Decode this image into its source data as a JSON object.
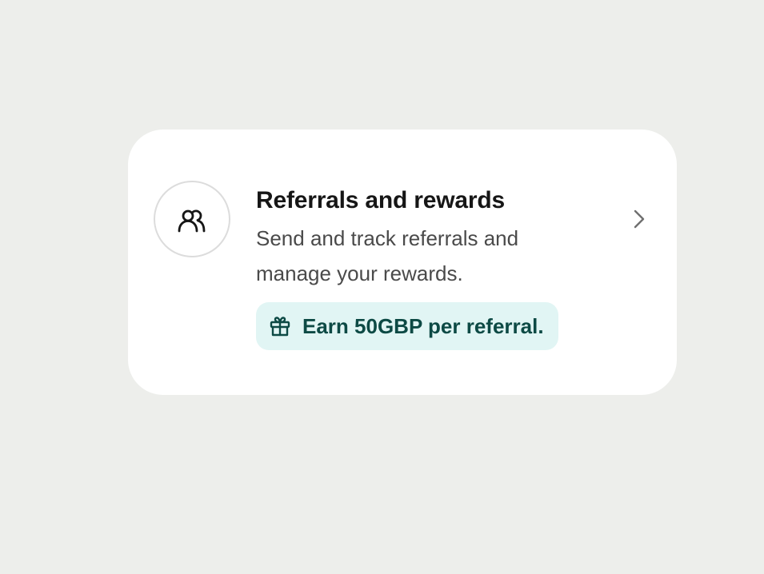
{
  "card": {
    "title": "Referrals and rewards",
    "description": "Send and track referrals and manage your rewards.",
    "badge": "Earn 50GBP per referral.",
    "icon": "users-icon",
    "badge_icon": "gift-icon",
    "action_icon": "chevron-right-icon"
  },
  "colors": {
    "background": "#edeeeb",
    "card": "#ffffff",
    "badge_bg": "#e1f5f4",
    "badge_text": "#0d4a45",
    "title": "#161616",
    "description": "#4a4a4a"
  }
}
